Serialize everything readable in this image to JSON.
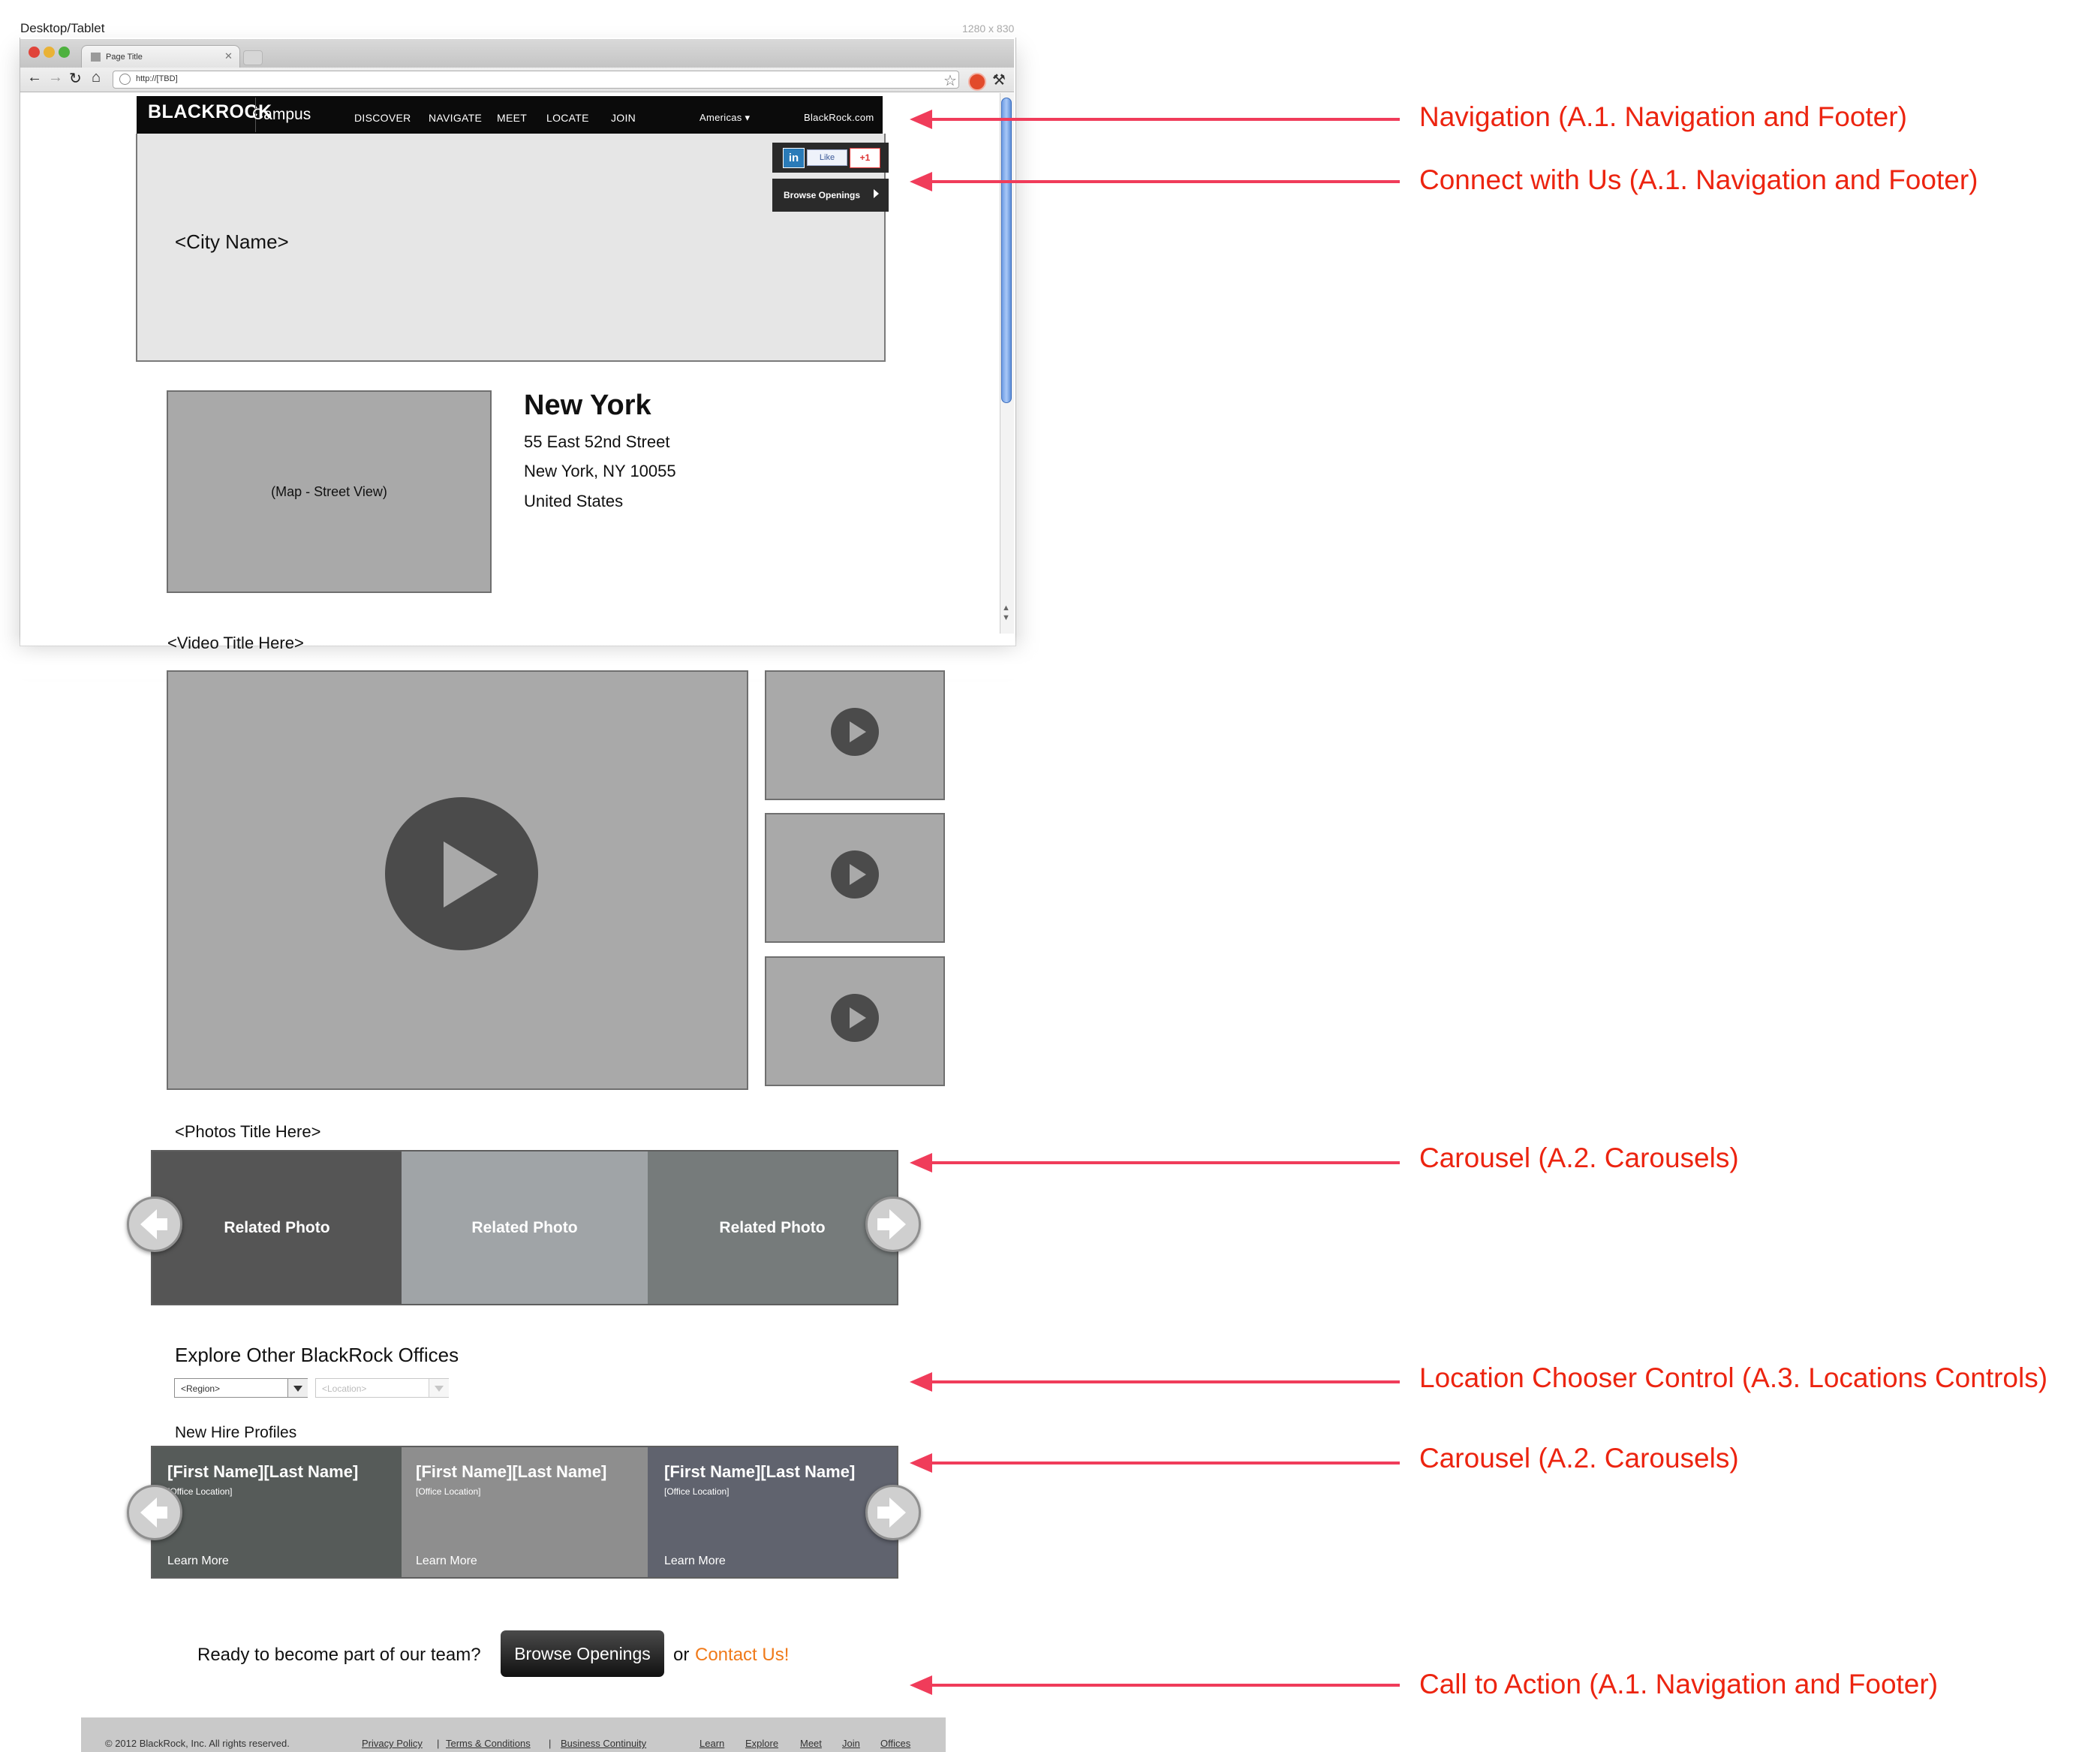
{
  "caption": {
    "device": "Desktop/Tablet",
    "size": "1280 x 830"
  },
  "browser": {
    "tab_title": "Page Title",
    "url": "http://[TBD]"
  },
  "nav": {
    "logo": "BLACKROCK",
    "campus": "Campus",
    "items": [
      "DISCOVER",
      "NAVIGATE",
      "MEET",
      "LOCATE",
      "JOIN"
    ],
    "region": "Americas ▾",
    "site_link": "BlackRock.com"
  },
  "hero": {
    "city_placeholder": "<City Name>",
    "social": {
      "linkedin": "in",
      "facebook": "Like",
      "gplus": "+1"
    },
    "browse_button": "Browse Openings"
  },
  "office": {
    "map_label": "(Map - Street View)",
    "city": "New York",
    "address_lines": [
      "55 East 52nd Street",
      "New York, NY 10055",
      "United States"
    ]
  },
  "video": {
    "title": "<Video Title Here>"
  },
  "photos": {
    "title": "<Photos Title Here>",
    "items": [
      {
        "label": "Related Photo",
        "color": "#555555"
      },
      {
        "label": "Related Photo",
        "color": "#a0a4a7"
      },
      {
        "label": "Related Photo",
        "color": "#767b7b"
      }
    ]
  },
  "explore": {
    "title": "Explore Other BlackRock Offices",
    "region_placeholder": "<Region>",
    "location_placeholder": "<Location>"
  },
  "profiles": {
    "title": "New Hire Profiles",
    "items": [
      {
        "name": "[First Name][Last Name]",
        "location": "[Office Location]",
        "more": "Learn More",
        "color": "#565b59"
      },
      {
        "name": "[First Name][Last Name]",
        "location": "[Office Location]",
        "more": "Learn More",
        "color": "#8e8e8e"
      },
      {
        "name": "[First Name][Last Name]",
        "location": "[Office Location]",
        "more": "Learn More",
        "color": "#60636e"
      }
    ]
  },
  "cta": {
    "question": "Ready to become part of our team?",
    "button": "Browse Openings",
    "or": "or",
    "contact": "Contact Us!"
  },
  "footer": {
    "copyright": "© 2012 BlackRock, Inc. All rights reserved.",
    "links": [
      "Privacy Policy",
      "Terms & Conditions",
      "Business Continuity"
    ],
    "nav_links": [
      "Learn",
      "Explore",
      "Meet",
      "Join",
      "Offices"
    ]
  },
  "annotations": [
    "Navigation (A.1. Navigation and Footer)",
    "Connect with Us (A.1. Navigation and Footer)",
    "Carousel (A.2. Carousels)",
    "Location Chooser Control (A.3. Locations Controls)",
    "Carousel (A.2. Carousels)",
    "Call to Action (A.1. Navigation and Footer)"
  ],
  "colors": {
    "accent": "#ec2410",
    "annotation_arrow": "#f03c5a",
    "contact_link": "#f07a1a"
  }
}
